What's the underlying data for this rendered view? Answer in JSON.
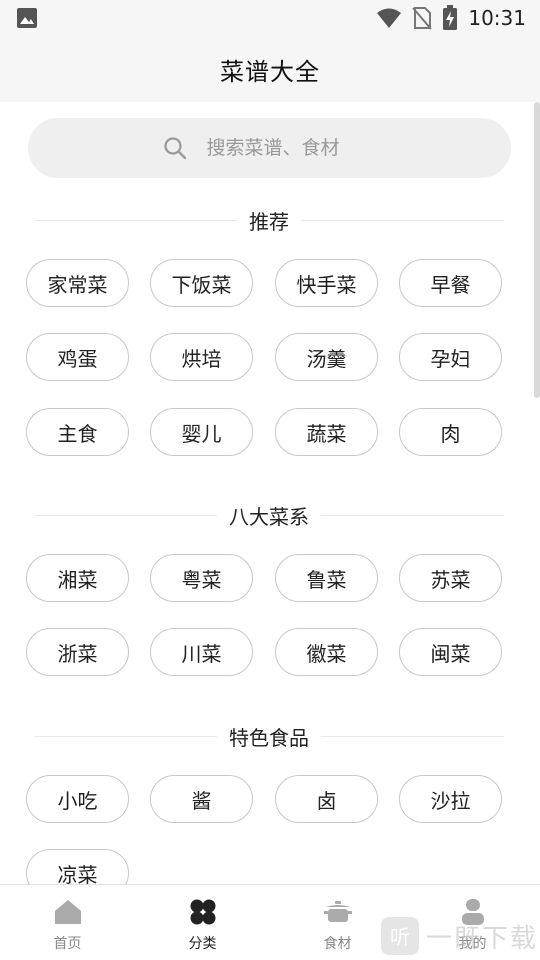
{
  "status_bar": {
    "time": "10:31",
    "icons": [
      "image-icon",
      "wifi-icon",
      "no-sim-icon",
      "battery-charging-icon"
    ]
  },
  "header": {
    "title": "菜谱大全"
  },
  "search": {
    "placeholder": "搜索菜谱、食材"
  },
  "sections": [
    {
      "title": "推荐",
      "chips": [
        "家常菜",
        "下饭菜",
        "快手菜",
        "早餐",
        "鸡蛋",
        "烘培",
        "汤羹",
        "孕妇",
        "主食",
        "婴儿",
        "蔬菜",
        "肉"
      ]
    },
    {
      "title": "八大菜系",
      "chips": [
        "湘菜",
        "粤菜",
        "鲁菜",
        "苏菜",
        "浙菜",
        "川菜",
        "徽菜",
        "闽菜"
      ]
    },
    {
      "title": "特色食品",
      "chips": [
        "小吃",
        "酱",
        "卤",
        "沙拉",
        "凉菜"
      ]
    }
  ],
  "tabs": [
    {
      "label": "首页",
      "icon": "home-icon",
      "active": false
    },
    {
      "label": "分类",
      "icon": "category-icon",
      "active": true
    },
    {
      "label": "食材",
      "icon": "pot-icon",
      "active": false
    },
    {
      "label": "我的",
      "icon": "user-icon",
      "active": false
    }
  ],
  "watermark": {
    "text": "一既下载"
  },
  "colors": {
    "header_bg": "#f6f6f6",
    "chip_border": "#c8c8c8",
    "active_tab": "#222222",
    "inactive_tab": "#888888"
  }
}
